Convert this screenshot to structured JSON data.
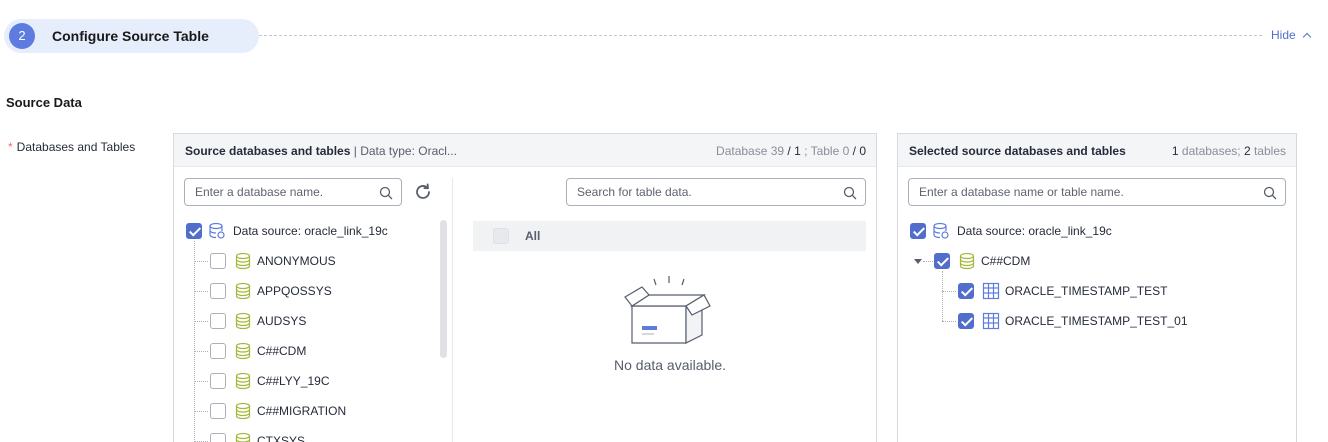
{
  "step": {
    "number": "2",
    "title": "Configure Source Table",
    "hide_label": "Hide"
  },
  "section": {
    "title": "Source Data"
  },
  "field": {
    "required_mark": "*",
    "label": "Databases and Tables"
  },
  "source_panel": {
    "title": "Source databases and tables",
    "separator": " | ",
    "data_type": "Data type: Oracl...",
    "db_label": "Database ",
    "db_total": "39",
    "db_slash": " / ",
    "db_selected": "1",
    "table_sep": " ; Table ",
    "table_total": "0",
    "table_slash": " / ",
    "table_selected": "0",
    "db_search_placeholder": "Enter a database name.",
    "table_search_placeholder": "Search for table data.",
    "datasource": "Data source: oracle_link_19c",
    "databases": [
      "ANONYMOUS",
      "APPQOSSYS",
      "AUDSYS",
      "C##CDM",
      "C##LYY_19C",
      "C##MIGRATION",
      "CTXSYS"
    ],
    "all_label": "All",
    "empty_text": "No data available."
  },
  "selected_panel": {
    "title": "Selected source databases and tables",
    "db_count": "1",
    "db_word": " databases; ",
    "table_count": "2",
    "table_word": " tables",
    "search_placeholder": "Enter a database name or table name.",
    "datasource": "Data source: oracle_link_19c",
    "database": "C##CDM",
    "tables": [
      "ORACLE_TIMESTAMP_TEST",
      "ORACLE_TIMESTAMP_TEST_01"
    ]
  },
  "colors": {
    "accent": "#526ecc",
    "step_bg": "#e6eefb",
    "db_icon": "#a6b83c",
    "table_icon": "#5e7ce0"
  }
}
